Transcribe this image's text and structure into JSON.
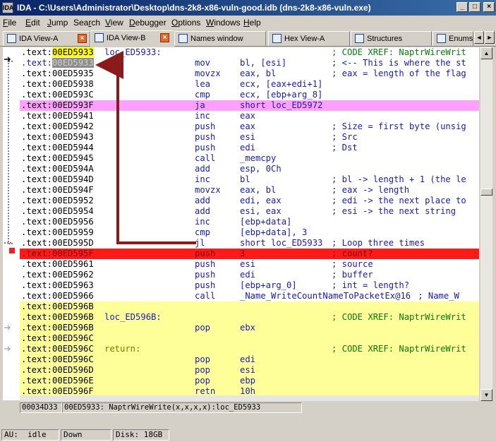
{
  "window": {
    "title": "IDA - C:\\Users\\Administrator\\Desktop\\dns-2k8-x86-vuln-good.idb (dns-2k8-x86-vuln.exe)",
    "app_icon_text": "IDA",
    "min_label": "_",
    "max_label": "□",
    "close_label": "×"
  },
  "menu": [
    "File",
    "Edit",
    "Jump",
    "Search",
    "View",
    "Debugger",
    "Options",
    "Windows",
    "Help"
  ],
  "menu_mnemonic": [
    "F",
    "E",
    "J",
    "r",
    "V",
    "D",
    "O",
    "W",
    "H"
  ],
  "tabs": [
    {
      "label": "IDA View-A",
      "icon": "ida-view-icon",
      "closable": true,
      "active": false
    },
    {
      "label": "IDA View-B",
      "icon": "ida-view-icon",
      "closable": true,
      "active": true
    },
    {
      "label": "Names window",
      "icon": "names-icon",
      "closable": false,
      "active": false
    },
    {
      "label": "Hex View-A",
      "icon": "hex-view-icon",
      "closable": false,
      "active": false
    },
    {
      "label": "Structures",
      "icon": "structures-icon",
      "closable": false,
      "active": false
    },
    {
      "label": "Enums",
      "icon": "enums-icon",
      "closable": false,
      "active": false
    }
  ],
  "tab_scroll": {
    "left": "◄",
    "right": "►"
  },
  "code": {
    "lines": [
      {
        "seg": ".text:",
        "addr": "00ED5933",
        "label": "loc_ED5933:",
        "mnemonic": "",
        "operands": "",
        "comment": "; CODE XREF: NaptrWireWrit",
        "bg": "",
        "addr_style": "yellow"
      },
      {
        "seg": ".text:",
        "addr": "00ED5933",
        "label": "",
        "mnemonic": "mov",
        "operands": "bl, [esi]",
        "comment": "; <-- This is where the st",
        "bg": "",
        "addr_style": "gray"
      },
      {
        "seg": ".text:",
        "addr": "00ED5935",
        "label": "",
        "mnemonic": "movzx",
        "operands": "eax, bl",
        "comment": "; eax = length of the flag",
        "bg": "",
        "addr_style": ""
      },
      {
        "seg": ".text:",
        "addr": "00ED5938",
        "label": "",
        "mnemonic": "lea",
        "operands": "ecx, [eax+edi+1]",
        "comment": "",
        "bg": "",
        "addr_style": ""
      },
      {
        "seg": ".text:",
        "addr": "00ED593C",
        "label": "",
        "mnemonic": "cmp",
        "operands": "ecx, [ebp+arg_8]",
        "comment": "",
        "bg": "",
        "addr_style": ""
      },
      {
        "seg": ".text:",
        "addr": "00ED593F",
        "label": "",
        "mnemonic": "ja",
        "operands": "short loc_ED5972",
        "comment": "",
        "bg": "pink",
        "addr_style": ""
      },
      {
        "seg": ".text:",
        "addr": "00ED5941",
        "label": "",
        "mnemonic": "inc",
        "operands": "eax",
        "comment": "",
        "bg": "",
        "addr_style": ""
      },
      {
        "seg": ".text:",
        "addr": "00ED5942",
        "label": "",
        "mnemonic": "push",
        "operands": "eax",
        "comment": "; Size = first byte (unsig",
        "bg": "",
        "addr_style": ""
      },
      {
        "seg": ".text:",
        "addr": "00ED5943",
        "label": "",
        "mnemonic": "push",
        "operands": "esi",
        "comment": "; Src",
        "bg": "",
        "addr_style": ""
      },
      {
        "seg": ".text:",
        "addr": "00ED5944",
        "label": "",
        "mnemonic": "push",
        "operands": "edi",
        "comment": "; Dst",
        "bg": "",
        "addr_style": ""
      },
      {
        "seg": ".text:",
        "addr": "00ED5945",
        "label": "",
        "mnemonic": "call",
        "operands": "_memcpy",
        "comment": "",
        "bg": "",
        "addr_style": ""
      },
      {
        "seg": ".text:",
        "addr": "00ED594A",
        "label": "",
        "mnemonic": "add",
        "operands": "esp, 0Ch",
        "comment": "",
        "bg": "",
        "addr_style": ""
      },
      {
        "seg": ".text:",
        "addr": "00ED594D",
        "label": "",
        "mnemonic": "inc",
        "operands": "bl",
        "comment": "; bl -> length + 1 (the le",
        "bg": "",
        "addr_style": ""
      },
      {
        "seg": ".text:",
        "addr": "00ED594F",
        "label": "",
        "mnemonic": "movzx",
        "operands": "eax, bl",
        "comment": "; eax -> length",
        "bg": "",
        "addr_style": ""
      },
      {
        "seg": ".text:",
        "addr": "00ED5952",
        "label": "",
        "mnemonic": "add",
        "operands": "edi, eax",
        "comment": "; edi -> the next place to",
        "bg": "",
        "addr_style": ""
      },
      {
        "seg": ".text:",
        "addr": "00ED5954",
        "label": "",
        "mnemonic": "add",
        "operands": "esi, eax",
        "comment": "; esi -> the next string",
        "bg": "",
        "addr_style": ""
      },
      {
        "seg": ".text:",
        "addr": "00ED5956",
        "label": "",
        "mnemonic": "inc",
        "operands": "[ebp+data]",
        "comment": "",
        "bg": "",
        "addr_style": ""
      },
      {
        "seg": ".text:",
        "addr": "00ED5959",
        "label": "",
        "mnemonic": "cmp",
        "operands": "[ebp+data], 3",
        "comment": "",
        "bg": "",
        "addr_style": ""
      },
      {
        "seg": ".text:",
        "addr": "00ED595D",
        "label": "",
        "mnemonic": "jl",
        "operands": "short loc_ED5933",
        "comment": "; Loop three times",
        "bg": "",
        "addr_style": ""
      },
      {
        "seg": ".text:",
        "addr": "00ED595F",
        "label": "",
        "mnemonic": "push",
        "operands": "3",
        "comment": "; count?",
        "bg": "red",
        "addr_style": ""
      },
      {
        "seg": ".text:",
        "addr": "00ED5961",
        "label": "",
        "mnemonic": "push",
        "operands": "esi",
        "comment": "; source",
        "bg": "",
        "addr_style": ""
      },
      {
        "seg": ".text:",
        "addr": "00ED5962",
        "label": "",
        "mnemonic": "push",
        "operands": "edi",
        "comment": "; buffer",
        "bg": "",
        "addr_style": ""
      },
      {
        "seg": ".text:",
        "addr": "00ED5963",
        "label": "",
        "mnemonic": "push",
        "operands": "[ebp+arg_0]",
        "comment": "; int = length?",
        "bg": "",
        "addr_style": ""
      },
      {
        "seg": ".text:",
        "addr": "00ED5966",
        "label": "",
        "mnemonic": "call",
        "operands": "_Name_WriteCountNameToPacketEx@16",
        "comment": "; Name_W",
        "bg": "",
        "addr_style": ""
      },
      {
        "seg": ".text:",
        "addr": "00ED596B",
        "label": "",
        "mnemonic": "",
        "operands": "",
        "comment": "",
        "bg": "yellow",
        "addr_style": ""
      },
      {
        "seg": ".text:",
        "addr": "00ED596B",
        "label": "loc_ED596B:",
        "mnemonic": "",
        "operands": "",
        "comment": "; CODE XREF: NaptrWireWrit",
        "bg": "yellow",
        "addr_style": ""
      },
      {
        "seg": ".text:",
        "addr": "00ED596B",
        "label": "",
        "mnemonic": "pop",
        "operands": "ebx",
        "comment": "",
        "bg": "yellow",
        "addr_style": ""
      },
      {
        "seg": ".text:",
        "addr": "00ED596C",
        "label": "",
        "mnemonic": "",
        "operands": "",
        "comment": "",
        "bg": "yellow",
        "addr_style": ""
      },
      {
        "seg": ".text:",
        "addr": "00ED596C",
        "label": "return:",
        "mnemonic": "",
        "operands": "",
        "comment": "; CODE XREF: NaptrWireWrit",
        "bg": "yellow",
        "addr_style": ""
      },
      {
        "seg": ".text:",
        "addr": "00ED596C",
        "label": "",
        "mnemonic": "pop",
        "operands": "edi",
        "comment": "",
        "bg": "yellow",
        "addr_style": ""
      },
      {
        "seg": ".text:",
        "addr": "00ED596D",
        "label": "",
        "mnemonic": "pop",
        "operands": "esi",
        "comment": "",
        "bg": "yellow",
        "addr_style": ""
      },
      {
        "seg": ".text:",
        "addr": "00ED596E",
        "label": "",
        "mnemonic": "pop",
        "operands": "ebp",
        "comment": "",
        "bg": "yellow",
        "addr_style": ""
      },
      {
        "seg": ".text:",
        "addr": "00ED596F",
        "label": "",
        "mnemonic": "retn",
        "operands": "10h",
        "comment": "",
        "bg": "yellow",
        "addr_style": ""
      }
    ]
  },
  "location": {
    "offset": "00034D33",
    "position": "00ED5933: NaptrWireWrite(x,x,x,x):loc_ED5933"
  },
  "status": {
    "au_label": "AU:",
    "au_state": "idle",
    "direction": "Down",
    "disk": "Disk: 18GB"
  },
  "colors": {
    "title_bar": "#0a246a",
    "highlight_yellow": "#ffff99",
    "breakpoint_red": "#ff1a1a",
    "jump_pink": "#ffa0ff",
    "code_blue": "#1a1ab0",
    "comment_green": "#0a7a0a",
    "arrow": "#8b1a1a"
  }
}
